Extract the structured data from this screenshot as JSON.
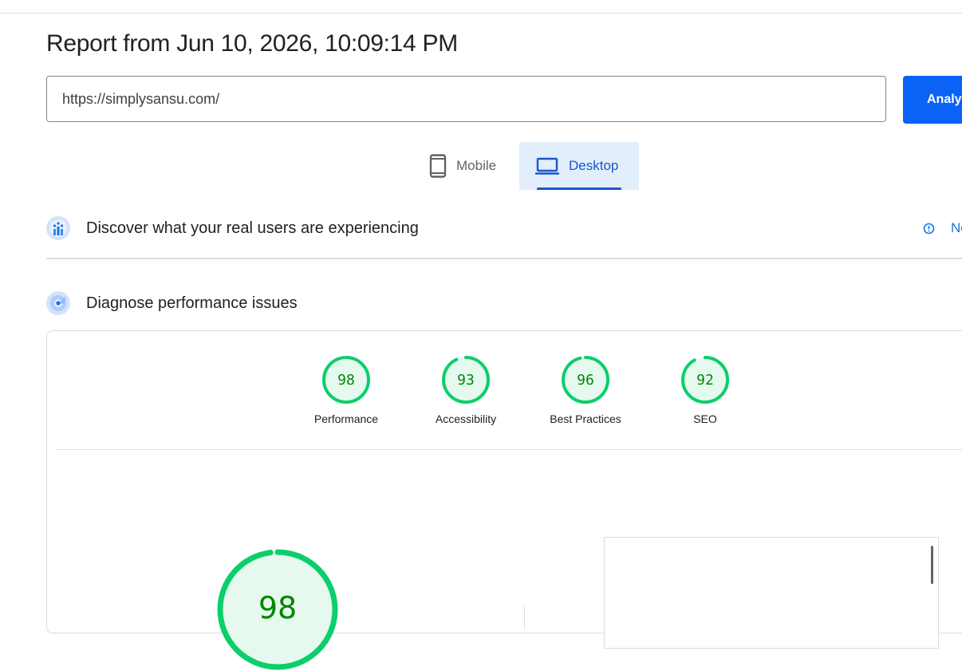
{
  "report": {
    "title": "Report from Jun 10, 2026, 10:09:14 PM"
  },
  "url_input": {
    "value": "https://simplysansu.com/"
  },
  "analyze_button": {
    "label": "Analy"
  },
  "tabs": [
    {
      "label": "Mobile",
      "icon": "phone-icon",
      "selected": false
    },
    {
      "label": "Desktop",
      "icon": "laptop-icon",
      "selected": true
    }
  ],
  "sections": {
    "real_users": {
      "title": "Discover what your real users are experiencing",
      "icon": "users-chart-icon",
      "link_label": "No"
    },
    "diagnose": {
      "title": "Diagnose performance issues",
      "icon": "radar-icon"
    }
  },
  "scores": [
    {
      "label": "Performance",
      "value": "98"
    },
    {
      "label": "Accessibility",
      "value": "93"
    },
    {
      "label": "Best Practices",
      "value": "96"
    },
    {
      "label": "SEO",
      "value": "92"
    }
  ],
  "big_score": {
    "value": "98"
  },
  "colors": {
    "pass_green": "#0cce6b",
    "pass_text": "#008800",
    "pass_fill": "#e6f9ef",
    "accent_blue": "#1a73e8"
  }
}
